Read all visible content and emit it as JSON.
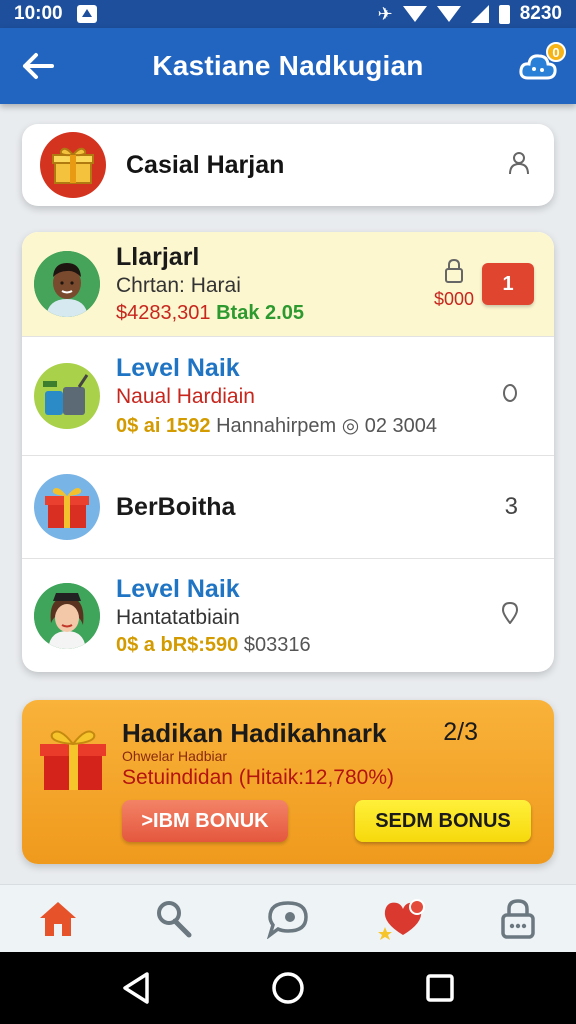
{
  "status_bar": {
    "time_left": "10:00",
    "time_right": "8230"
  },
  "app_bar": {
    "title": "Kastiane Nadkugian",
    "notification_count": "0"
  },
  "top_card": {
    "title": "Casial Harjan"
  },
  "list": [
    {
      "line1": "Llarjarl",
      "line2": "Chrtan: Harai",
      "line3_red": "$4283,301",
      "line3_green": "Btak 2.05",
      "amount": "$000",
      "badge": "1"
    },
    {
      "line1": "Level Naik",
      "line2": "Naual Hardiain",
      "line3_gold": "0$ ai 1592",
      "line3_grey": "Hannahirpem",
      "line3_tail": "02 3004"
    },
    {
      "line1": "BerBoitha",
      "side": "3"
    },
    {
      "line1": "Level Naik",
      "line2": "Hantatatbiain",
      "line3_gold": "0$ a bR$:590",
      "line3_grey": "$03316"
    }
  ],
  "bonus": {
    "title": "Hadikan Hadikahnark",
    "count": "2/3",
    "subtitle": "Ohwelar Hadbiar",
    "line": "Setuindidan (Hitaik:12,780%)",
    "button_red": ">IBM BONUK",
    "button_yellow": "SEDM BONUS"
  },
  "colors": {
    "app_bar": "#2265c1",
    "accent_orange": "#f4a62b",
    "red": "#e0452f",
    "yellow": "#f6d90c"
  },
  "bottom_nav": [
    "home-icon",
    "search-pin-icon",
    "chat-icon",
    "favorites-icon",
    "lock-icon"
  ]
}
